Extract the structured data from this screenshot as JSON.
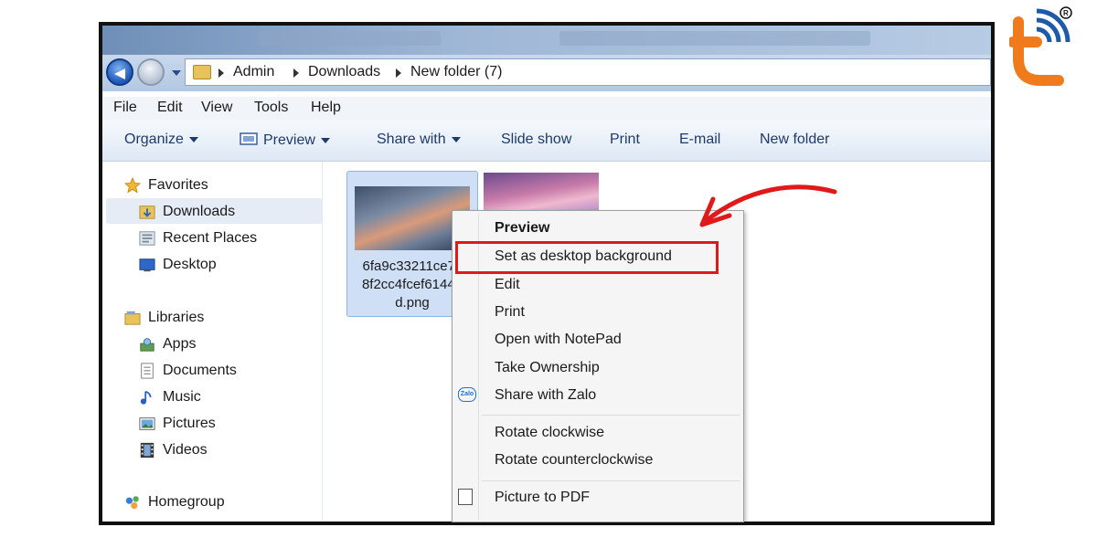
{
  "address": {
    "breadcrumbs": [
      "Admin",
      "Downloads",
      "New folder (7)"
    ]
  },
  "menubar": [
    "File",
    "Edit",
    "View",
    "Tools",
    "Help"
  ],
  "toolbar": {
    "organize": "Organize",
    "preview": "Preview",
    "share_with": "Share with",
    "slide_show": "Slide show",
    "print": "Print",
    "email": "E-mail",
    "new_folder": "New folder"
  },
  "sidebar": {
    "favorites": "Favorites",
    "downloads": "Downloads",
    "recent_places": "Recent Places",
    "desktop": "Desktop",
    "libraries": "Libraries",
    "apps": "Apps",
    "documents": "Documents",
    "music": "Music",
    "pictures": "Pictures",
    "videos": "Videos",
    "homegroup": "Homegroup"
  },
  "file": {
    "name_line1": "6fa9c33211ce7c",
    "name_line2": "8f2cc4fcef61441",
    "name_line3": "d.png"
  },
  "context_menu": {
    "preview": "Preview",
    "set_desktop_bg": "Set as desktop background",
    "edit": "Edit",
    "print": "Print",
    "open_notepad": "Open with NotePad",
    "take_ownership": "Take Ownership",
    "share_zalo": "Share with Zalo",
    "zalo_icon_text": "Zalo",
    "rotate_cw": "Rotate clockwise",
    "rotate_ccw": "Rotate counterclockwise",
    "picture_pdf": "Picture to PDF"
  },
  "colors": {
    "highlight_red": "#e0191b",
    "logo_orange": "#f07b1d",
    "logo_blue": "#1e5aa8"
  }
}
